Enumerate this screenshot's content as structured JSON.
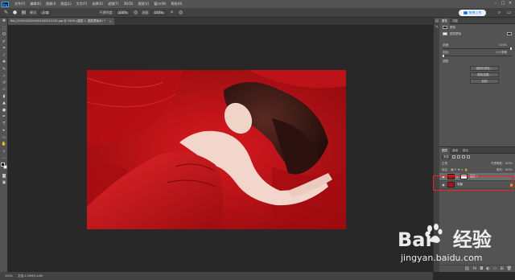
{
  "app": {
    "logo": "Ps",
    "menu": [
      "文件(F)",
      "编辑(E)",
      "图像(I)",
      "图层(L)",
      "文字(Y)",
      "选择(S)",
      "滤镜(T)",
      "3D(D)",
      "视图(V)",
      "窗口(W)",
      "帮助(H)"
    ]
  },
  "options": {
    "mode_label": "模式:",
    "mode_value": "正常",
    "opacity_label": "不透明度:",
    "opacity_value": "100%",
    "flow_label": "流量:",
    "flow_value": "100%",
    "upload_label": "拖拽上传"
  },
  "document": {
    "tab_title": "fbb_20190310001001052010130.jpg @ 100% (图层 1, 图层蒙版/8) *",
    "close_glyph": "×"
  },
  "status": {
    "zoom": "100%",
    "doc_size": "文档:1.09M/3.44M"
  },
  "properties": {
    "tabs": [
      "属性",
      "调整"
    ],
    "header_label": "蒙版",
    "mask_type": "图层蒙版",
    "density_label": "浓度:",
    "density_value": "100%",
    "feather_label": "羽化:",
    "feather_value": "0.0 像素",
    "refine_label": "调整:",
    "btn_select_mask": "选择并遮住...",
    "btn_color_range": "颜色范围...",
    "btn_invert": "反相"
  },
  "layers": {
    "tabs": [
      "图层",
      "通道",
      "路径"
    ],
    "kind_label": "类型",
    "blend_mode": "正常",
    "opacity_label": "不透明度:",
    "opacity_value": "100%",
    "lock_label": "锁定:",
    "fill_label": "填充:",
    "fill_value": "100%",
    "items": [
      {
        "name": "图层 1"
      },
      {
        "name": "背景"
      }
    ]
  },
  "watermark": {
    "brand": "Bai",
    "brand_cn": "经验",
    "url": "jingyan.baidu.com"
  },
  "colors": {
    "accent": "#31a8ff",
    "photo_red": "#c8141a",
    "selection_box": "#e22222"
  }
}
